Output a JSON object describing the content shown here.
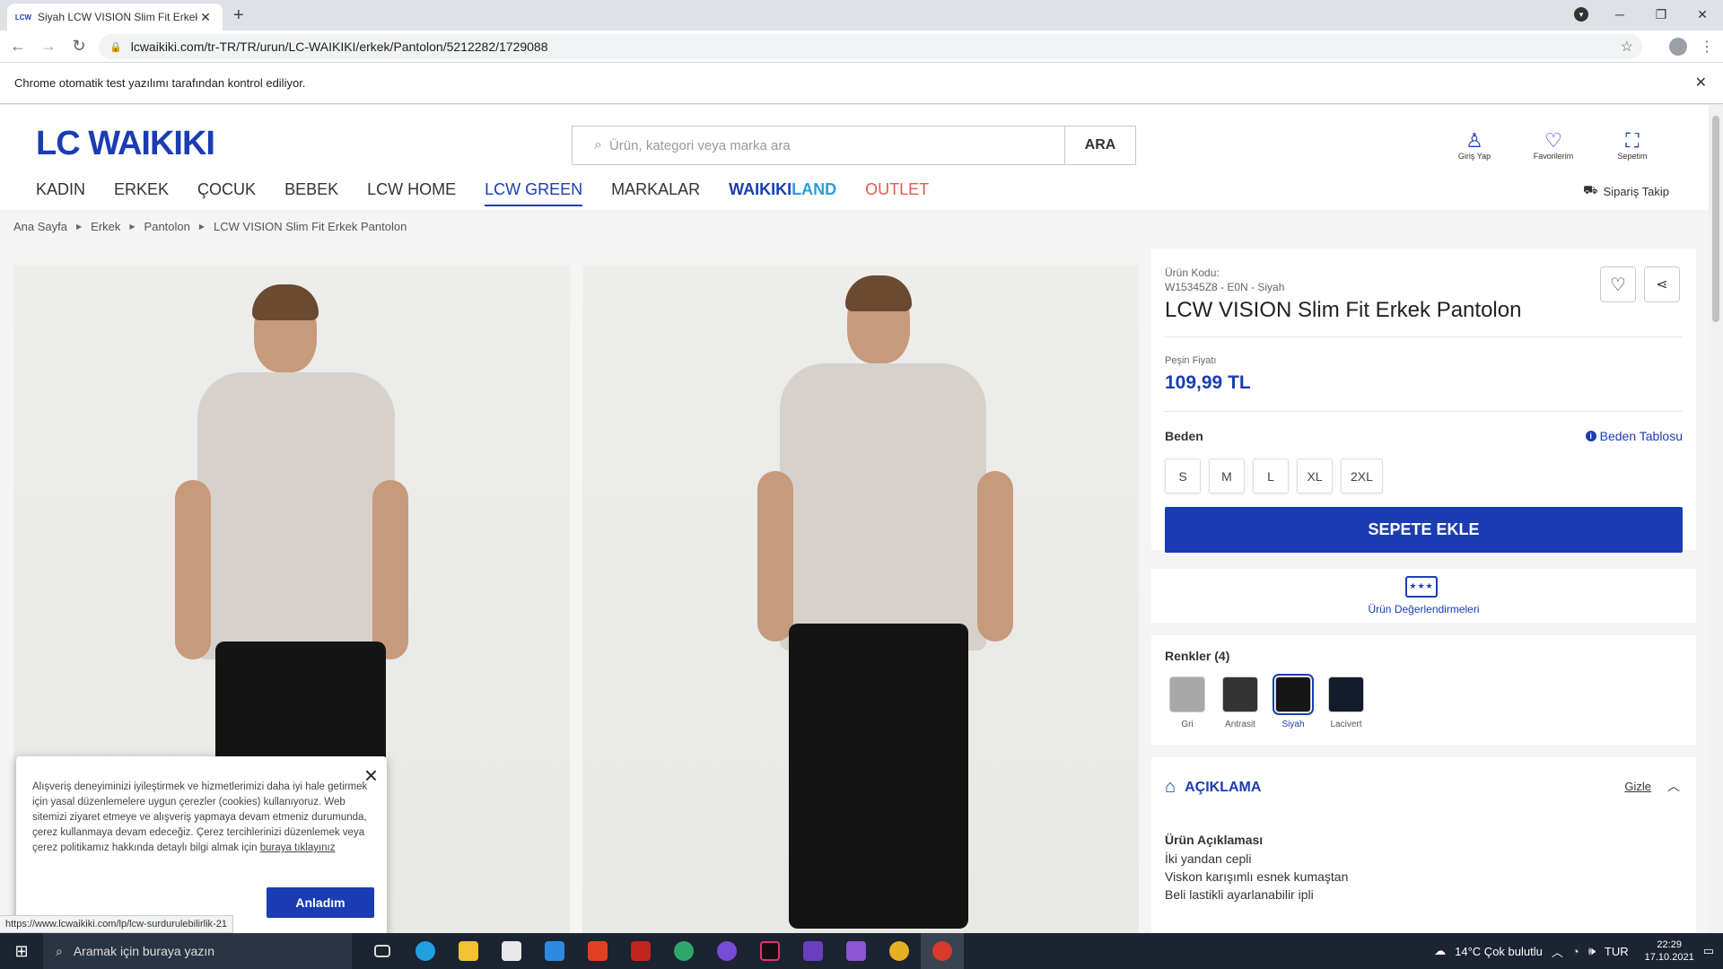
{
  "browser": {
    "tab_title": "Siyah LCW VISION Slim Fit Erkek",
    "tab_favicon": "LCW",
    "url": "lcwaikiki.com/tr-TR/TR/urun/LC-WAIKIKI/erkek/Pantolon/5212282/1729088",
    "infobar": "Chrome otomatik test yazılımı tarafından kontrol ediliyor."
  },
  "header": {
    "logo": "LC WAIKIKI",
    "search_placeholder": "Ürün, kategori veya marka ara",
    "search_button": "ARA",
    "icons": [
      {
        "label": "Giriş Yap",
        "icon": "user-icon"
      },
      {
        "label": "Favorilerim",
        "icon": "heart-icon"
      },
      {
        "label": "Sepetim",
        "icon": "bag-icon"
      }
    ],
    "nav": [
      "KADIN",
      "ERKEK",
      "ÇOCUK",
      "BEBEK",
      "LCW HOME",
      "LCW GREEN",
      "MARKALAR"
    ],
    "nav_waikiki": "WAIKIKI",
    "nav_land": "LAND",
    "nav_outlet": "OUTLET",
    "order_track": "Sipariş Takip"
  },
  "breadcrumb": [
    "Ana Sayfa",
    "Erkek",
    "Pantolon",
    "LCW VISION Slim Fit Erkek Pantolon"
  ],
  "product": {
    "code_label": "Ürün Kodu:",
    "code_value": "W15345Z8 - E0N - Siyah",
    "title": "LCW VISION Slim Fit Erkek Pantolon",
    "price_label": "Peşin Fiyatı",
    "price": "109,99 TL",
    "size_label": "Beden",
    "size_table": "Beden Tablosu",
    "sizes": [
      "S",
      "M",
      "L",
      "XL",
      "2XL"
    ],
    "add_to_cart": "SEPETE EKLE",
    "reviews_label": "Ürün Değerlendirmeleri",
    "colors_label": "Renkler (4)",
    "colors": [
      {
        "name": "Gri",
        "hex": "#a9a9a9"
      },
      {
        "name": "Antrasit",
        "hex": "#333333"
      },
      {
        "name": "Siyah",
        "hex": "#161616"
      },
      {
        "name": "Lacivert",
        "hex": "#141c2b"
      }
    ],
    "description_header": "AÇIKLAMA",
    "hide_label": "Gizle",
    "description_title": "Ürün Açıklaması",
    "description_lines": [
      "İki yandan cepli",
      "Viskon karışımlı esnek kumaştan",
      "Beli lastikli ayarlanabilir ipli"
    ]
  },
  "cookie": {
    "text": "Alışveriş deneyiminizi iyileştirmek ve hizmetlerimizi daha iyi hale getirmek için yasal düzenlemelere uygun çerezler (cookies) kullanıyoruz. Web sitemizi ziyaret etmeye ve alışveriş yapmaya devam etmeniz durumunda, çerez kullanmaya devam edeceğiz. Çerez tercihlerinizi düzenlemek veya çerez politikamız hakkında detaylı bilgi almak için",
    "link": "buraya tıklayınız",
    "button": "Anladım"
  },
  "status_url": "https://www.lcwaikiki.com/lp/lcw-surdurulebilirlik-21",
  "taskbar": {
    "search": "Aramak için buraya yazın",
    "weather": "14°C  Çok bulutlu",
    "lang": "TUR",
    "time": "22:29",
    "date": "17.10.2021"
  },
  "colors": {
    "brand_blue": "#1a3db3",
    "outlet_red": "#e05a4e"
  }
}
